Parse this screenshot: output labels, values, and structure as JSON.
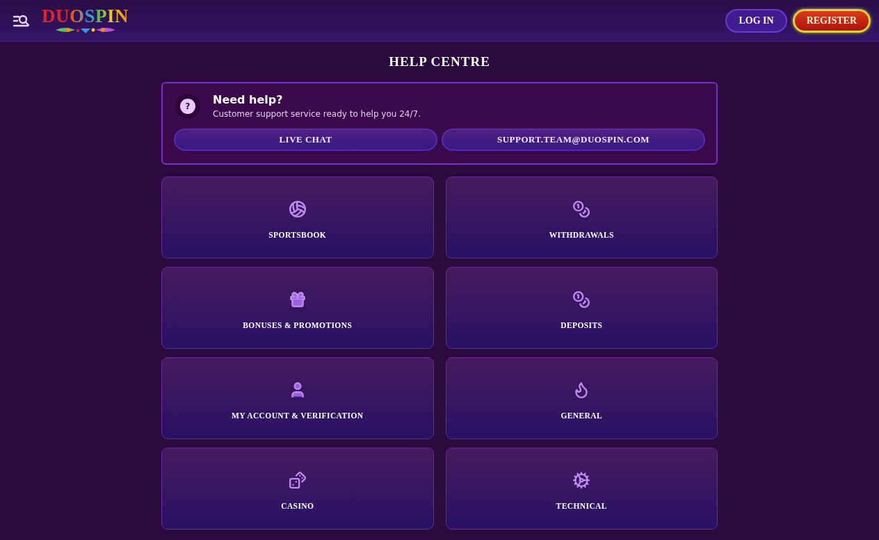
{
  "header": {
    "logo": "DUOSPIN",
    "buttons": [
      {
        "label": "LOG IN",
        "kind": "login"
      },
      {
        "label": "REGISTER",
        "kind": "register"
      }
    ]
  },
  "page_title": "HELP CENTRE",
  "help": {
    "icon": "?",
    "title": "Need help?",
    "subtitle": "Customer support service ready to help you 24/7.",
    "buttons": [
      "LIVE CHAT",
      "SUPPORT.TEAM@DUOSPIN.COM"
    ]
  },
  "categories": [
    {
      "label": "SPORTSBOOK",
      "kind": "sport"
    },
    {
      "label": "WITHDRAWALS",
      "kind": "withdraw"
    },
    {
      "label": "BONUSES & PROMOTIONS",
      "kind": "gift"
    },
    {
      "label": "DEPOSITS",
      "kind": "deposit"
    },
    {
      "label": "MY ACCOUNT & VERIFICATION",
      "kind": "account"
    },
    {
      "label": "GENERAL",
      "kind": "general"
    },
    {
      "label": "CASINO",
      "kind": "casino"
    },
    {
      "label": "TECHNICAL",
      "kind": "technical"
    }
  ]
}
